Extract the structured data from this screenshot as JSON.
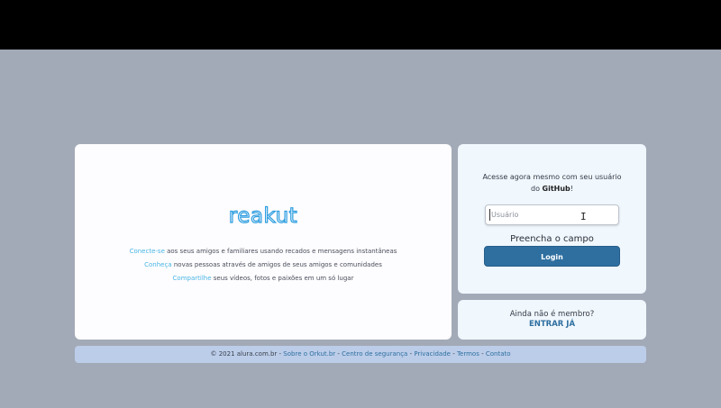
{
  "hero": {
    "logo": "reakut",
    "lines": [
      {
        "keyword": "Conecte-se",
        "text": " aos seus amigos e familiares usando recados e mensagens instantâneas"
      },
      {
        "keyword": "Conheça",
        "text": " novas pessoas através de amigos de seus amigos e comunidades"
      },
      {
        "keyword": "Compartilhe",
        "text": " seus vídeos, fotos e paixões em um só lugar"
      }
    ]
  },
  "login": {
    "prompt_line1": "Acesse agora mesmo com seu usuário",
    "prompt_pre": "do ",
    "prompt_bold": "GitHub",
    "prompt_post": "!",
    "username_placeholder": "Usuário",
    "username_value": "",
    "validation_message": "Preencha o campo",
    "login_label": "Login"
  },
  "signup": {
    "question": "Ainda não é membro?",
    "cta": "ENTRAR JÁ"
  },
  "footer": {
    "copyright": "© 2021 alura.com.br",
    "separator": " - ",
    "links": [
      "Sobre o Orkut.br",
      "Centro de segurança",
      "Privacidade",
      "Termos",
      "Contato"
    ]
  },
  "colors": {
    "background": "#a3aab7",
    "accent": "#2e6fa0",
    "keyword": "#49b6e6",
    "footer_bg": "#bccde9"
  }
}
